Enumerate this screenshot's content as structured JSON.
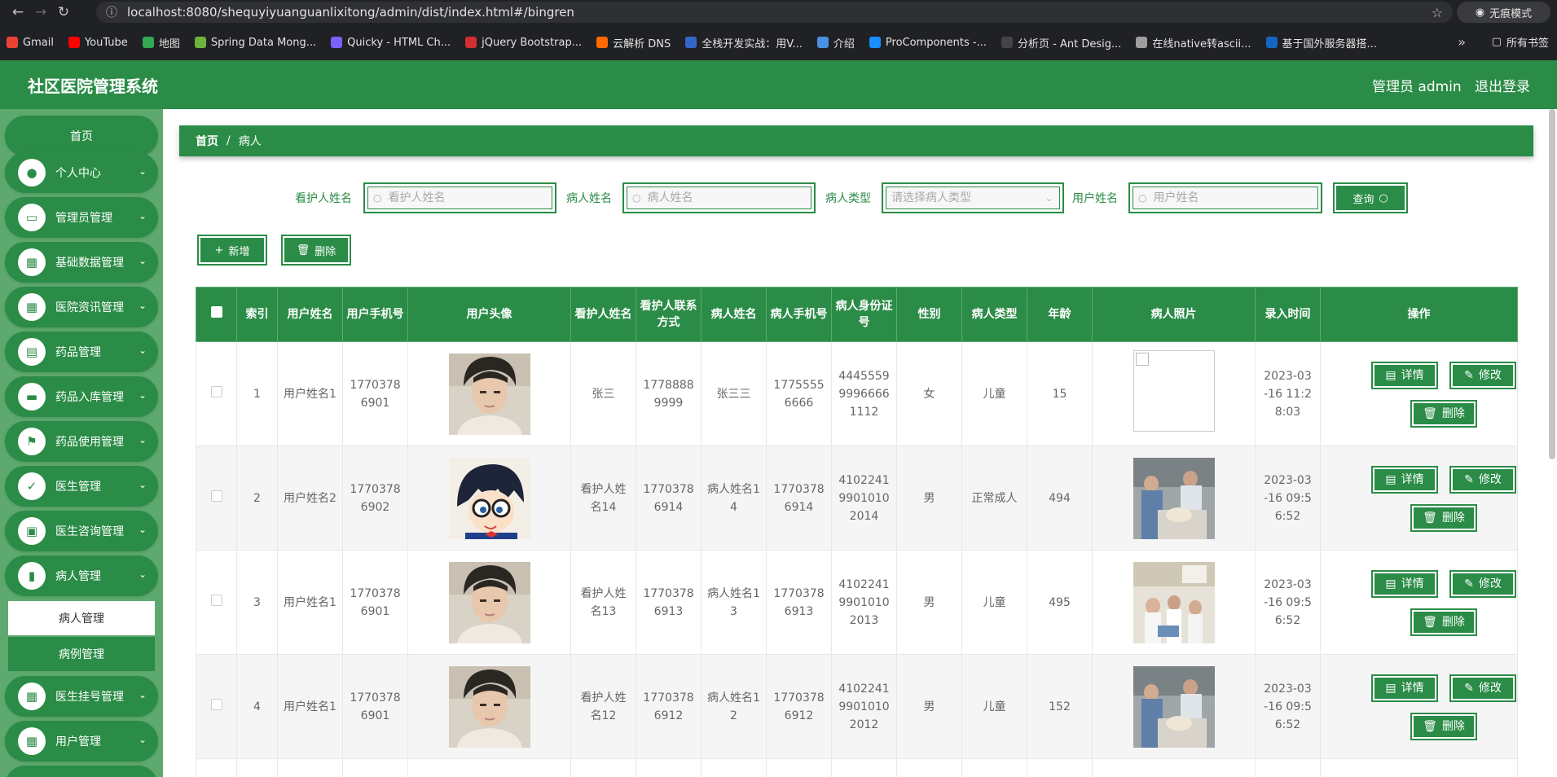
{
  "browser": {
    "url": "localhost:8080/shequyiyuanguanlixitong/admin/dist/index.html#/bingren",
    "incognito_label": "无痕模式",
    "all_bookmarks": "所有书签",
    "bookmarks": [
      {
        "label": "Gmail",
        "color": "#ea4335"
      },
      {
        "label": "YouTube",
        "color": "#ff0000"
      },
      {
        "label": "地图",
        "color": "#34a853"
      },
      {
        "label": "Spring Data Mong...",
        "color": "#6db33f"
      },
      {
        "label": "Quicky - HTML Ch...",
        "color": "#7b61ff"
      },
      {
        "label": "jQuery Bootstrap...",
        "color": "#d32f2f"
      },
      {
        "label": "云解析 DNS",
        "color": "#ff6a00"
      },
      {
        "label": "全栈开发实战：用V...",
        "color": "#3366cc"
      },
      {
        "label": "介绍",
        "color": "#4a90e2"
      },
      {
        "label": "ProComponents -...",
        "color": "#1890ff"
      },
      {
        "label": "分析页 - Ant Desig...",
        "color": "#444444"
      },
      {
        "label": "在线native转ascii...",
        "color": "#9e9e9e"
      },
      {
        "label": "基于国外服务器搭...",
        "color": "#1565c0"
      }
    ]
  },
  "header": {
    "title": "社区医院管理系统",
    "admin": "管理员 admin",
    "logout": "退出登录"
  },
  "sidebar": {
    "home": "首页",
    "items": [
      {
        "label": "个人中心",
        "icon": "user-icon",
        "glyph": "●"
      },
      {
        "label": "管理员管理",
        "icon": "monitor-icon",
        "glyph": "▭"
      },
      {
        "label": "基础数据管理",
        "icon": "grid-icon",
        "glyph": "▦"
      },
      {
        "label": "医院资讯管理",
        "icon": "grid-icon",
        "glyph": "▦"
      },
      {
        "label": "药品管理",
        "icon": "clipboard-icon",
        "glyph": "▤"
      },
      {
        "label": "药品入库管理",
        "icon": "message-icon",
        "glyph": "▬"
      },
      {
        "label": "药品使用管理",
        "icon": "flag-icon",
        "glyph": "⚑"
      },
      {
        "label": "医生管理",
        "icon": "checklist-icon",
        "glyph": "✓"
      },
      {
        "label": "医生咨询管理",
        "icon": "briefcase-icon",
        "glyph": "▣"
      },
      {
        "label": "病人管理",
        "icon": "chart-icon",
        "glyph": "▮"
      }
    ],
    "sub_items": [
      "病人管理",
      "病例管理"
    ],
    "bottom_items": [
      {
        "label": "医生挂号管理",
        "icon": "grid-icon",
        "glyph": "▦"
      },
      {
        "label": "用户管理",
        "icon": "grid-icon",
        "glyph": "▦"
      }
    ]
  },
  "breadcrumb": {
    "home": "首页",
    "sep": "/",
    "current": "病人"
  },
  "search": {
    "caretaker_label": "看护人姓名",
    "caretaker_placeholder": "看护人姓名",
    "patient_label": "病人姓名",
    "patient_placeholder": "病人姓名",
    "type_label": "病人类型",
    "type_placeholder": "请选择病人类型",
    "user_label": "用户姓名",
    "user_placeholder": "用户姓名",
    "query": "查询"
  },
  "actions": {
    "add": "新增",
    "delete": "删除"
  },
  "table": {
    "headers": [
      "索引",
      "用户姓名",
      "用户手机号",
      "用户头像",
      "看护人姓名",
      "看护人联系方式",
      "病人姓名",
      "病人手机号",
      "病人身份证号",
      "性别",
      "病人类型",
      "年龄",
      "病人照片",
      "录入时间",
      "操作"
    ],
    "row_actions": {
      "detail": "详情",
      "edit": "修改",
      "delete": "删除"
    },
    "rows": [
      {
        "index": "1",
        "user_name": "用户姓名1",
        "user_phone": "17703786901",
        "avatar": "young-man",
        "caretaker": "张三",
        "caretaker_phone": "17788889999",
        "patient": "张三三",
        "patient_phone": "17755556666",
        "id_card": "444555999966661112",
        "gender": "女",
        "type": "儿童",
        "age": "15",
        "photo": "broken",
        "time": "2023-03-16 11:28:03"
      },
      {
        "index": "2",
        "user_name": "用户姓名2",
        "user_phone": "17703786902",
        "avatar": "cartoon",
        "caretaker": "看护人姓名14",
        "caretaker_phone": "17703786914",
        "patient": "病人姓名14",
        "patient_phone": "17703786914",
        "id_card": "410224199010102014",
        "gender": "男",
        "type": "正常成人",
        "age": "494",
        "photo": "clinic",
        "time": "2023-03-16 09:56:52"
      },
      {
        "index": "3",
        "user_name": "用户姓名1",
        "user_phone": "17703786901",
        "avatar": "young-man",
        "caretaker": "看护人姓名13",
        "caretaker_phone": "17703786913",
        "patient": "病人姓名13",
        "patient_phone": "17703786913",
        "id_card": "410224199010102013",
        "gender": "男",
        "type": "儿童",
        "age": "495",
        "photo": "ward",
        "time": "2023-03-16 09:56:52"
      },
      {
        "index": "4",
        "user_name": "用户姓名1",
        "user_phone": "17703786901",
        "avatar": "young-man",
        "caretaker": "看护人姓名12",
        "caretaker_phone": "17703786912",
        "patient": "病人姓名12",
        "patient_phone": "17703786912",
        "id_card": "410224199010102012",
        "gender": "男",
        "type": "儿童",
        "age": "152",
        "photo": "clinic",
        "time": "2023-03-16 09:56:52"
      }
    ]
  },
  "colors": {
    "primary": "#2a8c46",
    "sidebar_bg": "#5ea96f"
  }
}
